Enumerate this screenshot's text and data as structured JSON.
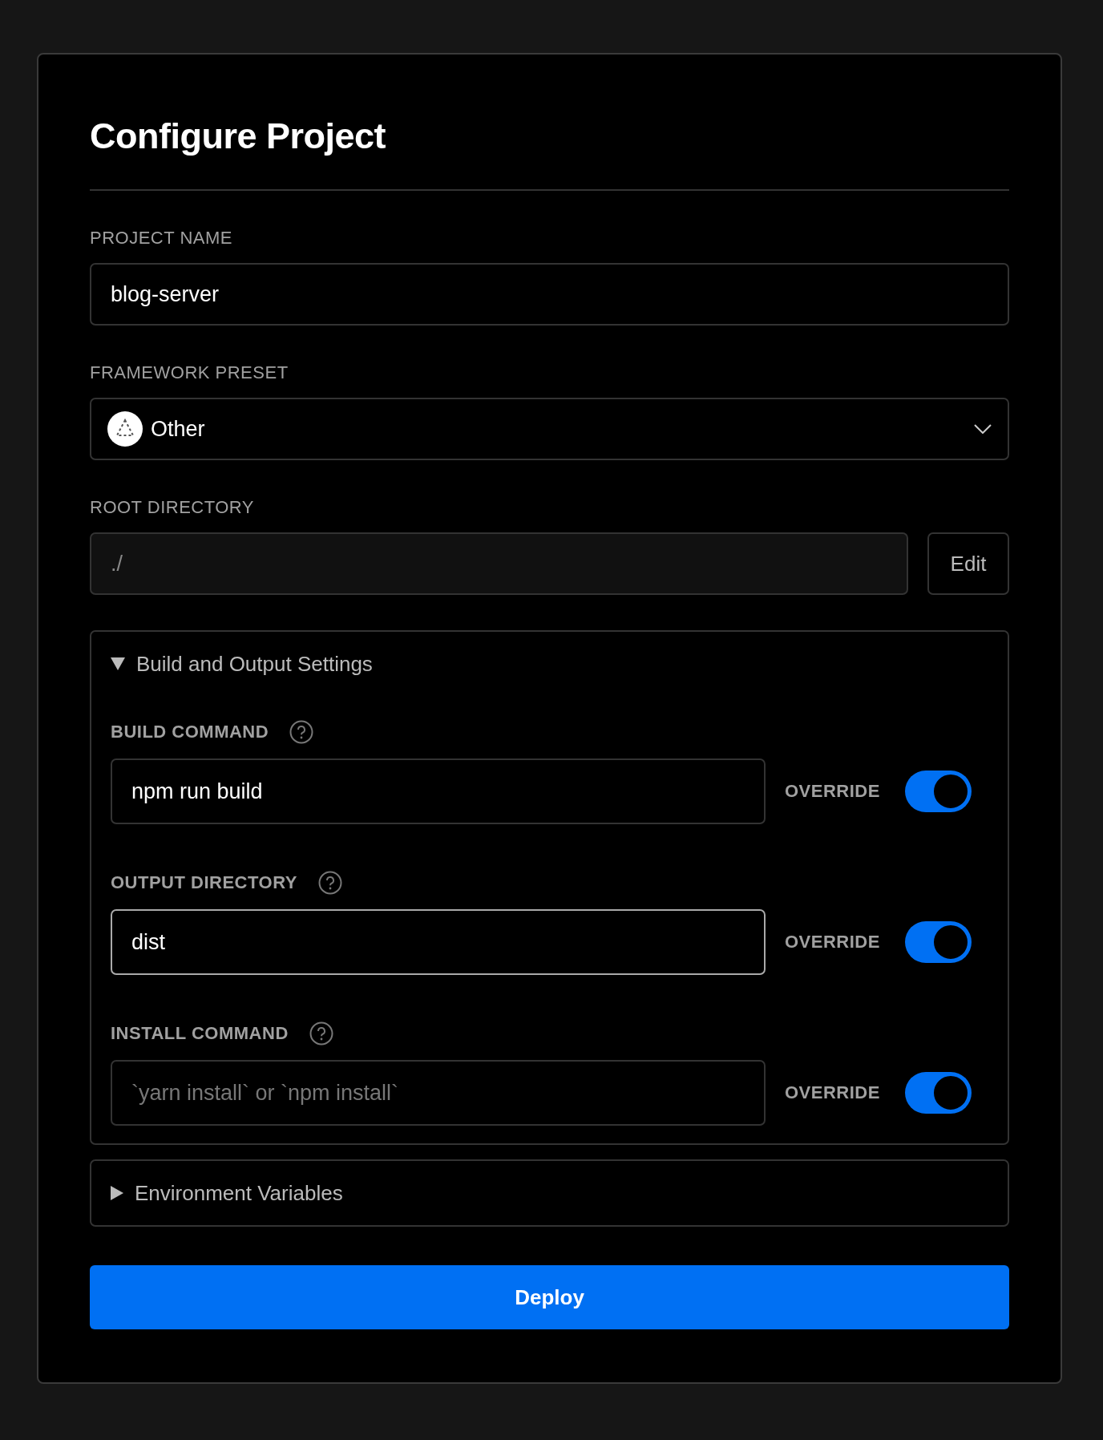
{
  "title": "Configure Project",
  "fields": [
    {
      "kind": "text",
      "label": "PROJECT NAME",
      "value": "blog-server"
    },
    {
      "kind": "select",
      "label": "FRAMEWORK PRESET",
      "value": "Other"
    },
    {
      "kind": "readonly",
      "label": "ROOT DIRECTORY",
      "value": "./",
      "button": "Edit"
    }
  ],
  "sections": [
    {
      "title": "Build and Output Settings",
      "expanded": true,
      "settings": [
        {
          "label": "BUILD COMMAND",
          "value": "npm run build",
          "focused": false,
          "override_label": "OVERRIDE",
          "override": true
        },
        {
          "label": "OUTPUT DIRECTORY",
          "value": "dist",
          "focused": true,
          "override_label": "OVERRIDE",
          "override": true
        },
        {
          "label": "INSTALL COMMAND",
          "placeholder": "`yarn install` or `npm install`",
          "focused": false,
          "override_label": "OVERRIDE",
          "override": true
        }
      ]
    },
    {
      "title": "Environment Variables",
      "expanded": false
    }
  ],
  "deploy": "Deploy"
}
